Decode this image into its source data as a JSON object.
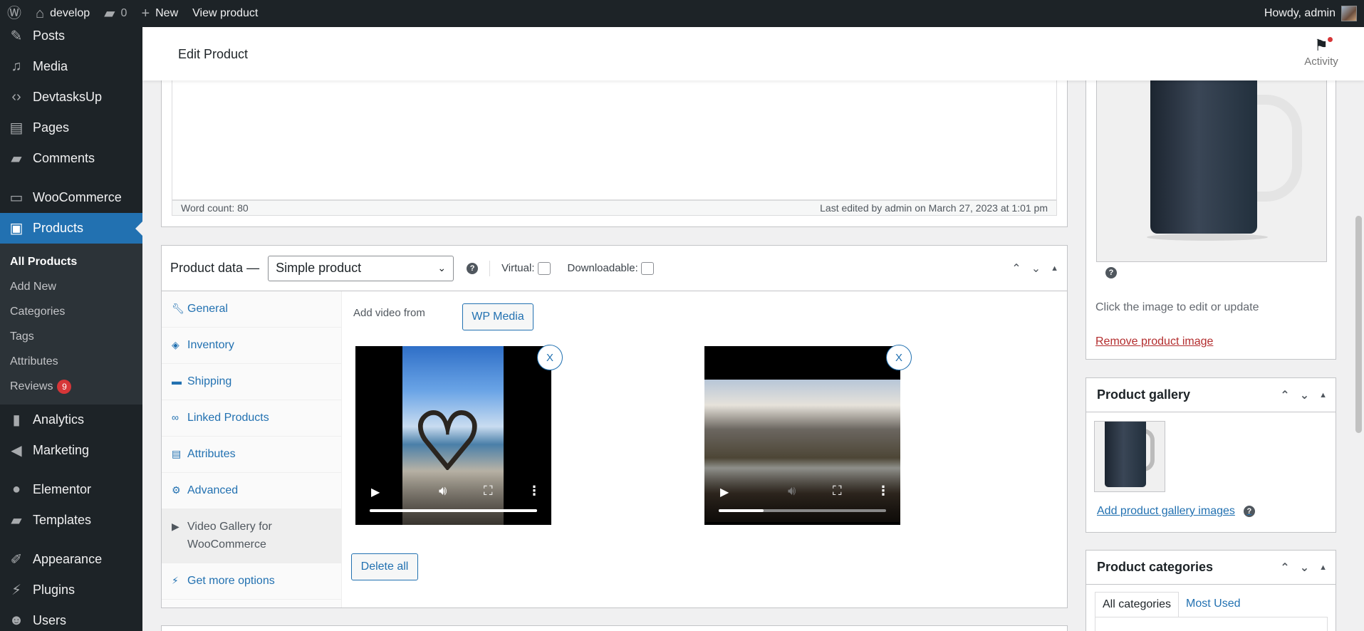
{
  "adminbar": {
    "site_name": "develop",
    "comments_count": "0",
    "new_label": "New",
    "view_product_label": "View product",
    "howdy": "Howdy, admin"
  },
  "sidebar": {
    "items": [
      {
        "label": "Posts",
        "icon": "pin-icon"
      },
      {
        "label": "Media",
        "icon": "media-icon"
      },
      {
        "label": "DevtasksUp",
        "icon": "code-icon"
      },
      {
        "label": "Pages",
        "icon": "page-icon"
      },
      {
        "label": "Comments",
        "icon": "comment-icon"
      },
      {
        "label": "WooCommerce",
        "icon": "woo-icon"
      },
      {
        "label": "Products",
        "icon": "archive-icon"
      },
      {
        "label": "Analytics",
        "icon": "chart-icon"
      },
      {
        "label": "Marketing",
        "icon": "megaphone-icon"
      },
      {
        "label": "Elementor",
        "icon": "elementor-icon"
      },
      {
        "label": "Templates",
        "icon": "folder-icon"
      },
      {
        "label": "Appearance",
        "icon": "brush-icon"
      },
      {
        "label": "Plugins",
        "icon": "plugin-icon"
      },
      {
        "label": "Users",
        "icon": "user-icon"
      }
    ],
    "submenu": [
      {
        "label": "All Products"
      },
      {
        "label": "Add New"
      },
      {
        "label": "Categories"
      },
      {
        "label": "Tags"
      },
      {
        "label": "Attributes"
      },
      {
        "label": "Reviews",
        "badge": "9"
      }
    ]
  },
  "header": {
    "title": "Edit Product",
    "activity_label": "Activity"
  },
  "editor": {
    "word_count": "Word count: 80",
    "last_edited": "Last edited by admin on March 27, 2023 at 1:01 pm"
  },
  "product_data": {
    "title": "Product data —",
    "type_value": "Simple product",
    "virtual_label": "Virtual:",
    "downloadable_label": "Downloadable:",
    "tabs": [
      {
        "label": "General"
      },
      {
        "label": "Inventory"
      },
      {
        "label": "Shipping"
      },
      {
        "label": "Linked Products"
      },
      {
        "label": "Attributes"
      },
      {
        "label": "Advanced"
      },
      {
        "label": "Video Gallery for WooCommerce"
      },
      {
        "label": "Get more options"
      }
    ],
    "add_video_label": "Add video from",
    "wp_media_label": "WP Media",
    "delete_all_label": "Delete all",
    "close_label": "X",
    "video1_progress": 1.0,
    "video2_progress": 0.27
  },
  "product_image": {
    "hint": "Click the image to edit or update",
    "remove_label": "Remove product image"
  },
  "gallery": {
    "title": "Product gallery",
    "add_label": "Add product gallery images"
  },
  "categories": {
    "title": "Product categories",
    "tab_all": "All categories",
    "tab_most_used": "Most Used"
  },
  "colors": {
    "accent": "#2271b1",
    "adminbar": "#1d2327",
    "badge": "#d63638",
    "remove_link": "#b32d2e"
  }
}
